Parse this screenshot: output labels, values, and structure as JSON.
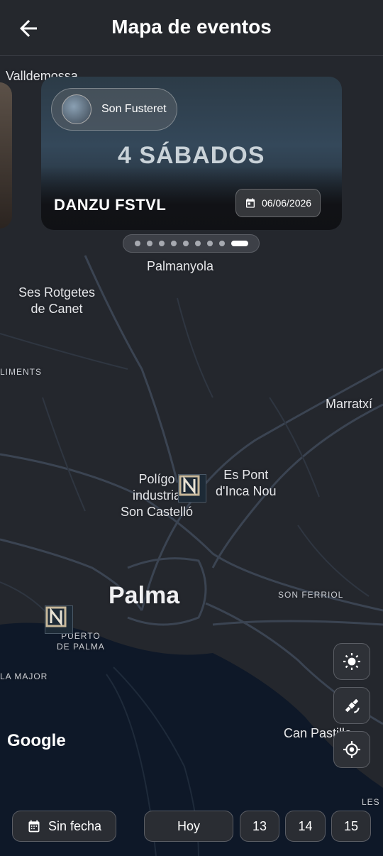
{
  "header": {
    "title": "Mapa de eventos"
  },
  "carousel": {
    "venue": "Son Fusteret",
    "event_name": "DANZU FSTVL",
    "date": "06/06/2026",
    "screen_text": "4 SÁBADOS",
    "page_count": 9,
    "active_page": 9
  },
  "map_labels": {
    "valldemossa": "Valldemossa",
    "palmanyola": "Palmanyola",
    "ses_rotgetes": "Ses Rotgetes\nde Canet",
    "liments": "LIMENTS",
    "marratxi": "Marratxí",
    "poligono": "Polígo\nindustria\nSon Castelló",
    "es_pont": "Es Pont\nd'Inca Nou",
    "palma": "Palma",
    "son_ferriol": "SON FERRIOL",
    "puerto": "PUERTO\nDE PALMA",
    "la_major": "LA MAJOR",
    "can_pastilla": "Can Pastilla",
    "les": "LES"
  },
  "google_logo": "Google",
  "date_filter": {
    "no_date": "Sin fecha",
    "today": "Hoy",
    "days": [
      "13",
      "14",
      "15"
    ]
  },
  "icons": [
    "back-arrow-icon",
    "calendar-icon",
    "brightness-icon",
    "satellite-icon",
    "my-location-icon",
    "venue-marker-icon"
  ]
}
